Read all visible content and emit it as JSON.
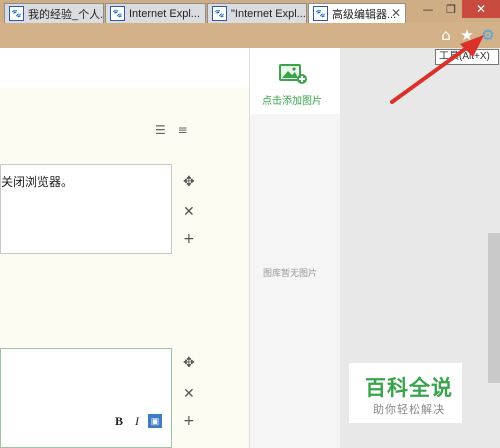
{
  "window": {
    "minimize_glyph": "—",
    "restore_glyph": "❐",
    "close_glyph": "✕"
  },
  "tabs": [
    {
      "label": "我的经验_个人..."
    },
    {
      "label": "Internet Expl..."
    },
    {
      "label": "\"Internet Expl..."
    },
    {
      "label": "高级编辑器...",
      "active": true
    }
  ],
  "tab_close_glyph": "✕",
  "nav_icons": [
    {
      "name": "home-icon",
      "glyph": "⌂"
    },
    {
      "name": "star-icon",
      "glyph": "★"
    },
    {
      "name": "gear-icon",
      "glyph": "⚙"
    }
  ],
  "tooltip": "工具(Alt+X)",
  "editor": {
    "paragraph_text": "关闭浏览器。",
    "list_icons": [
      "ordered-list-icon",
      "unordered-list-icon"
    ],
    "controls": {
      "move": "✥",
      "remove": "✕",
      "add": "+"
    },
    "mini_toolbar": {
      "bold": "B",
      "italic": "I"
    }
  },
  "image_panel": {
    "add_label": "点击添加图片",
    "empty_text": "图库暂无图片"
  },
  "watermark": {
    "title": "百科全说",
    "subtitle": "助你轻松解决"
  },
  "colors": {
    "accent_green": "#3aa34b",
    "arrow_red": "#d9322b",
    "gear_blue": "#4aa7e0"
  }
}
